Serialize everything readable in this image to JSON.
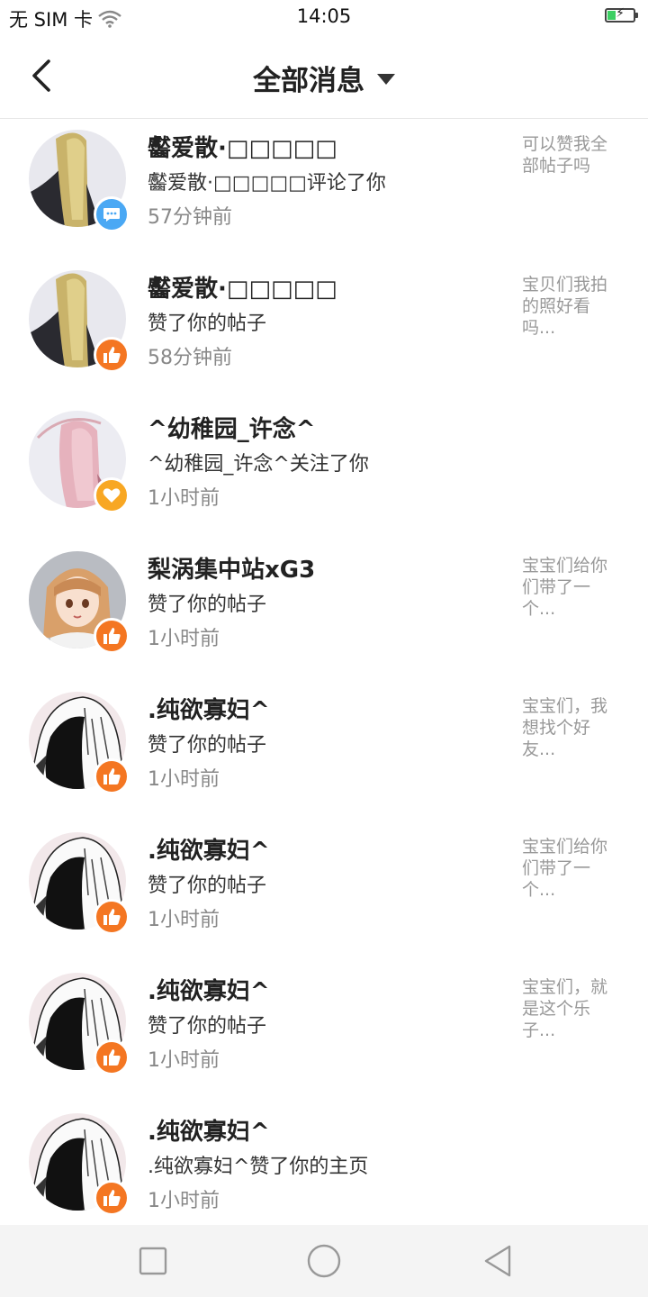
{
  "status_bar": {
    "carrier": "无 SIM 卡",
    "time": "14:05"
  },
  "header": {
    "title": "全部消息"
  },
  "messages": [
    {
      "name": "齾爱散·□□□□□",
      "action": "齾爱散·□□□□□评论了你",
      "time": "57分钟前",
      "preview": "可以赞我全部帖子吗",
      "badge": "comment-icon",
      "avatar": "blonde-hair-avatar"
    },
    {
      "name": "齾爱散·□□□□□",
      "action": "赞了你的帖子",
      "time": "58分钟前",
      "preview": "宝贝们我拍的照好看吗...",
      "badge": "thumbs-up-icon",
      "avatar": "blonde-hair-avatar"
    },
    {
      "name": "^幼稚园_许念^",
      "action": "^幼稚园_许念^关注了你",
      "time": "1小时前",
      "preview": "",
      "badge": "heart-icon",
      "avatar": "pink-hair-avatar"
    },
    {
      "name": "梨涡集中站xG3",
      "action": "赞了你的帖子",
      "time": "1小时前",
      "preview": "宝宝们给你们带了一个...",
      "badge": "thumbs-up-icon",
      "avatar": "anime-girl-avatar"
    },
    {
      "name": ".纯欲寡妇^",
      "action": "赞了你的帖子",
      "time": "1小时前",
      "preview": "宝宝们，我想找个好友...",
      "badge": "thumbs-up-icon",
      "avatar": "hooded-figure-avatar"
    },
    {
      "name": ".纯欲寡妇^",
      "action": "赞了你的帖子",
      "time": "1小时前",
      "preview": "宝宝们给你们带了一个...",
      "badge": "thumbs-up-icon",
      "avatar": "hooded-figure-avatar"
    },
    {
      "name": ".纯欲寡妇^",
      "action": "赞了你的帖子",
      "time": "1小时前",
      "preview": "宝宝们，就是这个乐子...",
      "badge": "thumbs-up-icon",
      "avatar": "hooded-figure-avatar"
    },
    {
      "name": ".纯欲寡妇^",
      "action": ".纯欲寡妇^赞了你的主页",
      "time": "1小时前",
      "preview": "",
      "badge": "thumbs-up-icon",
      "avatar": "hooded-figure-avatar"
    }
  ],
  "colors": {
    "like_badge": "#f47622",
    "comment_badge": "#4aa8f4",
    "follow_badge": "#f8a723",
    "battery_fill": "#3ccf63"
  },
  "battery": {
    "level": 0.35
  }
}
